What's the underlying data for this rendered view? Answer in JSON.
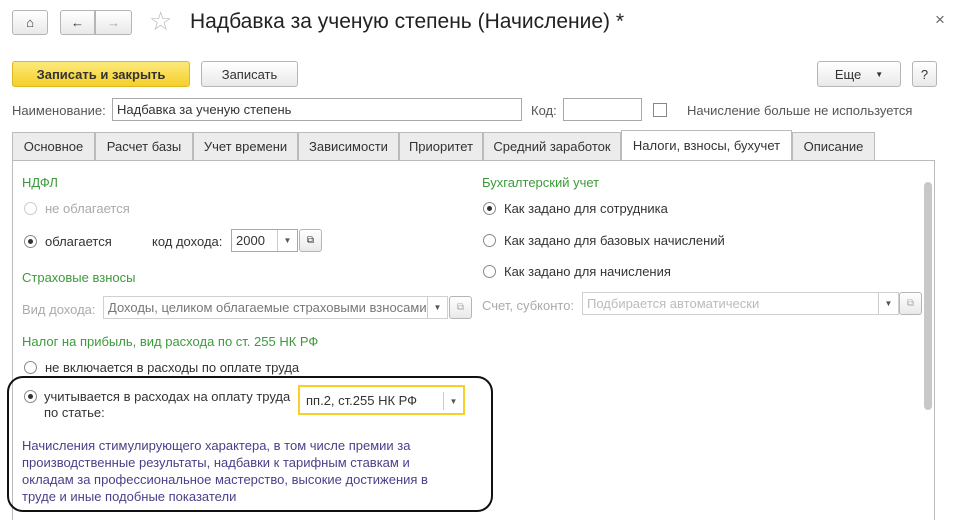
{
  "header": {
    "title": "Надбавка за ученую степень (Начисление) *",
    "close": "×"
  },
  "toolbar": {
    "save_close": "Записать и закрыть",
    "save": "Записать",
    "more": "Еще",
    "more_arrow": "▼",
    "help": "?"
  },
  "form": {
    "name_label": "Наименование:",
    "name_value": "Надбавка за ученую степень",
    "code_label": "Код:",
    "code_value": "",
    "unused_label": "Начисление больше не используется",
    "unused_checked": false
  },
  "tabs": [
    {
      "label": "Основное"
    },
    {
      "label": "Расчет базы"
    },
    {
      "label": "Учет времени"
    },
    {
      "label": "Зависимости"
    },
    {
      "label": "Приоритет"
    },
    {
      "label": "Средний заработок"
    },
    {
      "label": "Налоги, взносы, бухучет",
      "active": true
    },
    {
      "label": "Описание"
    }
  ],
  "ndfl": {
    "title": "НДФЛ",
    "not_taxed": "не облагается",
    "taxed": "облагается",
    "income_code_label": "код дохода:",
    "income_code": "2000",
    "selected": "taxed"
  },
  "insurance": {
    "title": "Страховые взносы",
    "income_type_label": "Вид дохода:",
    "income_type": "Доходы, целиком облагаемые страховыми взносами"
  },
  "profit_tax": {
    "title": "Налог на прибыль, вид расхода по ст. 255 НК РФ",
    "not_included": "не включается в расходы по оплате труда",
    "included": "учитывается в расходах на оплату труда по статье:",
    "article": "пп.2, ст.255 НК РФ",
    "description": "Начисления стимулирующего характера, в том числе премии за производственные результаты, надбавки к тарифным ставкам и окладам за профессиональное мастерство, высокие достижения в труде и иные подобные показатели",
    "selected": "included"
  },
  "accounting": {
    "title": "Бухгалтерский учет",
    "options": [
      "Как задано для сотрудника",
      "Как задано для базовых начислений",
      "Как задано для начисления"
    ],
    "selected": 0,
    "account_label": "Счет, субконто:",
    "account_placeholder": "Подбирается автоматически"
  },
  "colors": {
    "accent": "#f5cf2a",
    "section": "#3c9a3c",
    "description": "#4b3f8a"
  }
}
